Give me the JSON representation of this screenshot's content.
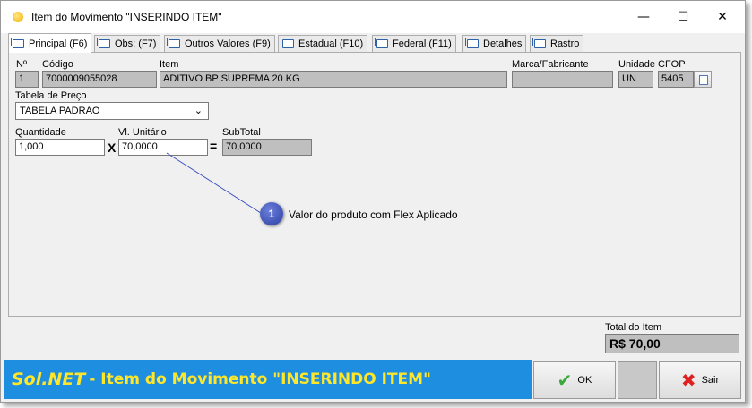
{
  "window": {
    "title": "Item do Movimento \"INSERINDO ITEM\"",
    "minimize": "—",
    "maximize": "☐",
    "close": "✕"
  },
  "tabs": [
    {
      "label": "Principal (F6)"
    },
    {
      "label": "Obs: (F7)"
    },
    {
      "label": "Outros Valores (F9)"
    },
    {
      "label": "Estadual (F10)"
    },
    {
      "label": "Federal (F11)"
    },
    {
      "label": "Detalhes"
    },
    {
      "label": "Rastro"
    }
  ],
  "form": {
    "num_label": "Nº",
    "num_value": "1",
    "codigo_label": "Código",
    "codigo_value": "7000009055028",
    "item_label": "Item",
    "item_value": "ADITIVO BP SUPREMA 20 KG",
    "marca_label": "Marca/Fabricante",
    "marca_value": "",
    "unidade_label": "Unidade",
    "unidade_value": "UN",
    "cfop_label": "CFOP",
    "cfop_value": "5405",
    "tabela_label": "Tabela de Preço",
    "tabela_value": "TABELA PADRAO",
    "quantidade_label": "Quantidade",
    "quantidade_value": "1,000",
    "multiply": "X",
    "vl_unitario_label": "Vl. Unitário",
    "vl_unitario_value": "70,0000",
    "equals": "=",
    "subtotal_label": "SubTotal",
    "subtotal_value": "70,0000"
  },
  "annotation": {
    "number": "1",
    "text": "Valor do produto com Flex Aplicado"
  },
  "total": {
    "label": "Total do Item",
    "value": "R$ 70,00"
  },
  "brand": {
    "logo": "Sol.NET",
    "text": "- Item do Movimento \"INSERINDO ITEM\""
  },
  "buttons": {
    "ok": "OK",
    "sair": "Sair"
  },
  "colors": {
    "brand_bar": "#1e8fe0",
    "brand_text": "#ffe629",
    "readonly_field": "#bfbfbf",
    "annotation_badge": "#3a4fbf"
  }
}
